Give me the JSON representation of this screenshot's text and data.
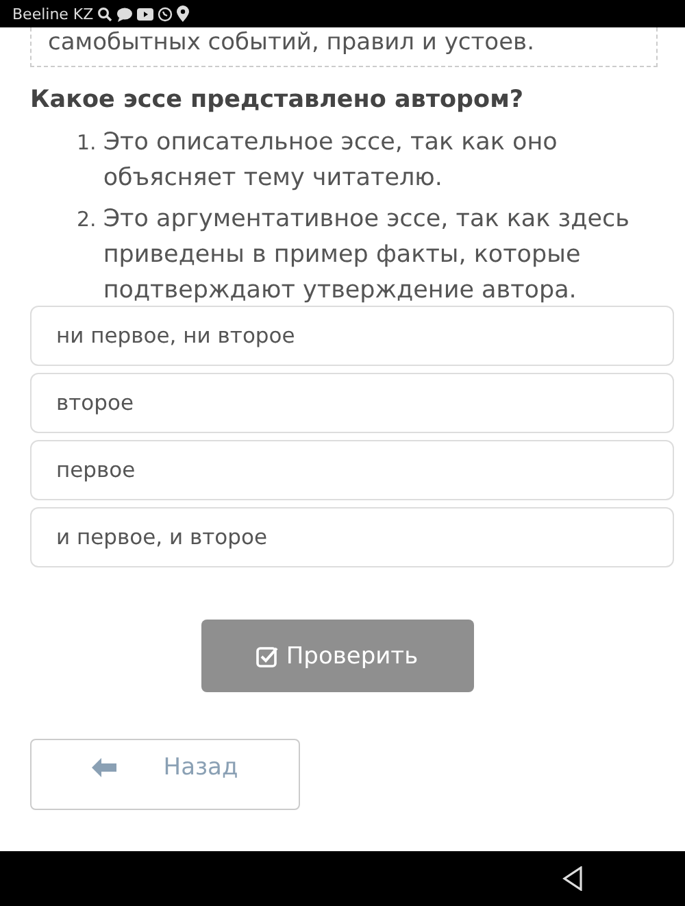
{
  "status_bar": {
    "carrier": "Beeline KZ"
  },
  "passage": {
    "tail": "самобытных событий, правил и устоев."
  },
  "question": {
    "title": "Какое эссе представлено автором?",
    "statements": [
      {
        "number": "1.",
        "text": "Это описательное эссе, так как оно объясняет тему читателю."
      },
      {
        "number": "2.",
        "text": "Это аргументативное эссе, так как здесь приведены в пример факты, которые подтверждают утверждение автора."
      }
    ]
  },
  "options": [
    {
      "label": "ни первое, ни второе",
      "selected": false
    },
    {
      "label": "второе",
      "selected": false
    },
    {
      "label": "первое",
      "selected": false
    },
    {
      "label": "и первое, и второе",
      "selected": false
    }
  ],
  "check_button": {
    "label": "Проверить",
    "disabled": true
  },
  "back_button": {
    "label": "Назад"
  }
}
